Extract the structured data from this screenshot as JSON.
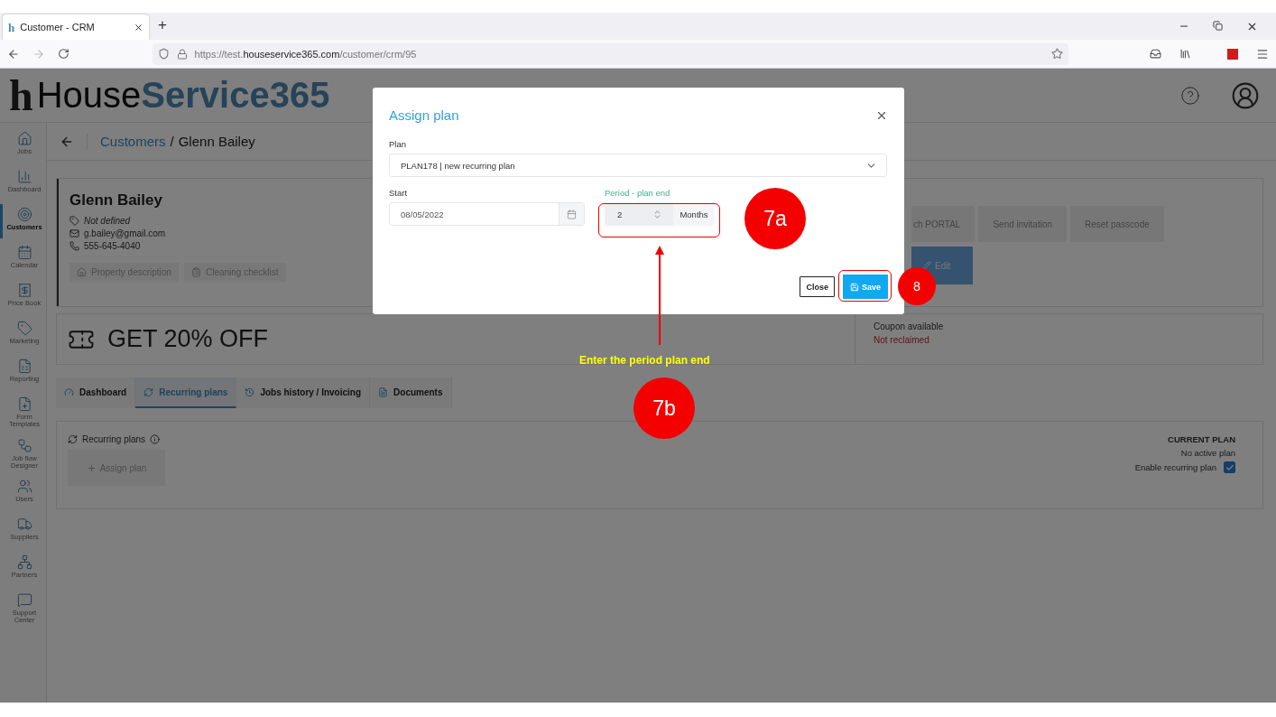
{
  "browser": {
    "favicon": "h",
    "tab_title": "Customer - CRM",
    "new_tab": "+",
    "url_prefix": "https://test.",
    "url_host": "houseservice365.com",
    "url_path": "/customer/crm/95"
  },
  "logo": {
    "mark": "h",
    "first": "House",
    "second": "Service365"
  },
  "sidebar": {
    "items": [
      {
        "label": "Jobs",
        "selected": false
      },
      {
        "label": "Dashboard",
        "selected": false
      },
      {
        "label": "Customers",
        "selected": true
      },
      {
        "label": "Calendar",
        "selected": false
      },
      {
        "label": "Price Book",
        "selected": false
      },
      {
        "label": "Marketing",
        "selected": false
      },
      {
        "label": "Reporting",
        "selected": false
      },
      {
        "label": "Form Templates",
        "selected": false
      },
      {
        "label": "Job flow Designer",
        "selected": false
      },
      {
        "label": "Users",
        "selected": false
      },
      {
        "label": "Suppliers",
        "selected": false
      },
      {
        "label": "Partners",
        "selected": false
      },
      {
        "label": "Support Center",
        "selected": false
      }
    ]
  },
  "breadcrumb": {
    "link": "Customers",
    "separator": "/",
    "current": "Glenn Bailey"
  },
  "customer": {
    "name": "Glenn Bailey",
    "tag": "Not defined",
    "email": "g.bailey@gmail.com",
    "phone": "555-645-4040",
    "buttons": [
      "Property description",
      "Cleaning checklist"
    ],
    "portal_buttons": [
      "ch PORTAL",
      "Send invitation",
      "Reset passcode"
    ],
    "edit": "Edit"
  },
  "coupon": {
    "headline": "GET 20% OFF",
    "status_label": "Coupon available",
    "status": "Not reclaimed"
  },
  "tabs": [
    {
      "label": "Dashboard",
      "selected": false
    },
    {
      "label": "Recurring plans",
      "selected": true
    },
    {
      "label": "Jobs history / Invoicing",
      "selected": false
    },
    {
      "label": "Documents",
      "selected": false
    }
  ],
  "recurring": {
    "title": "Recurring plans",
    "assign": "Assign plan",
    "current_plan_label": "CURRENT PLAN",
    "current_plan": "No active plan",
    "enable_label": "Enable recurring plan",
    "enable_checked": true
  },
  "modal": {
    "title": "Assign plan",
    "plan_label": "Plan",
    "plan_value": "PLAN178 | new recurring plan",
    "start_label": "Start",
    "start_value": "08/05/2022",
    "period_label": "Period - plan end",
    "period_value": "2",
    "period_unit": "Months",
    "close": "Close",
    "save": "Save"
  },
  "annotations": {
    "steps": [
      "7a",
      "7b",
      "8"
    ],
    "instruction": "Enter the period plan end"
  }
}
